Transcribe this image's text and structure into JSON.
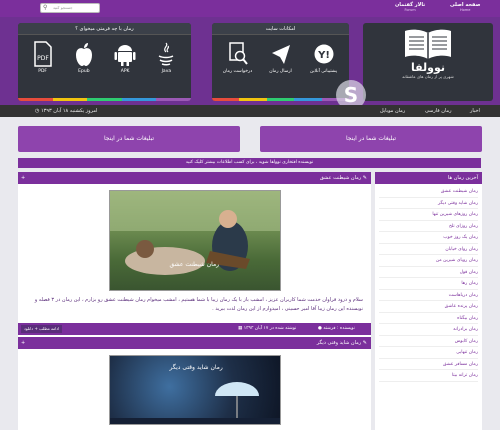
{
  "topbar": {
    "search_placeholder": "جستجو کنید",
    "nav": [
      {
        "label": "صفحه اصلی",
        "sub": "Home"
      },
      {
        "label": "تالار گفتمان",
        "sub": "Forum"
      }
    ]
  },
  "formats_panel": {
    "title": "رمان با چه فرمتی میخوای ؟",
    "items": [
      {
        "label": "PDF",
        "icon": "pdf-icon"
      },
      {
        "label": "Epub",
        "icon": "apple-icon"
      },
      {
        "label": "APK",
        "icon": "android-icon"
      },
      {
        "label": "Java",
        "icon": "java-icon"
      }
    ]
  },
  "site_panel": {
    "title": "امکانات سایت",
    "items": [
      {
        "label": "درخواست رمان",
        "icon": "request-icon"
      },
      {
        "label": "ارسال رمان",
        "icon": "send-icon"
      },
      {
        "label": "پشتیبانی آنلاین",
        "icon": "support-icon"
      }
    ]
  },
  "logo": {
    "name": "نوولفا",
    "slogan": "شهری پر از رمان های عاشقانه"
  },
  "navbar": {
    "date": "امروز یکشنبه ۱۸ آبان ۱۳۹۳",
    "items": [
      "اخبار",
      "رمان فارسی",
      "رمان موبایل"
    ]
  },
  "ads": {
    "left": "تبلیغات شما در اینجا",
    "right": "تبلیغات شما در اینجا"
  },
  "notice": "نویسنده افتخاری نوولفا شوید ، برای کسب اطلاعات بیشتر کلیک کنید",
  "posts": [
    {
      "title": "رمان شیطنت عشق",
      "image_caption": "رمان شیطنت عشق",
      "excerpt": "سلام و درود فراوان خدمت شما کاربران عزیز ، امشب باز با یک رمان زیبا با شما هستیم ، امشب میخوام رمان شیطنت عشق رو بزارم ، این رمان در ۳ فصله و نویسنده این رمان زیبا آقا امیر حسینی ، امیدوارم از این رمان لذت ببرید .",
      "author": "نویسنده : فرشته",
      "date": "نوشته شده در ۱۷ آبان ۱۳۹۳",
      "more": "ادامه مطلب + دانلود"
    },
    {
      "title": "رمان شاید وقتی دیگر",
      "image_caption": "رمان شاید وقتی دیگر"
    }
  ],
  "sidebar": {
    "title": "آخرین رمان ها",
    "items": [
      "رمان شیطنت عشق",
      "رمان شاید وقتی دیگر",
      "رمان روزهای شیرین تنها",
      "رمان روزای تلخ",
      "رمان یک روز خوب",
      "رمان روای خیابان",
      "رمان رویای شیرین من",
      "رمان قول",
      "رمان رها",
      "رمان دریاهاست",
      "رمان پرنده عاشق",
      "رمان بیگناه",
      "رمان برادرانه",
      "رمان کابوس",
      "رمان تنهایی",
      "رمان مسافر عشق",
      "رمان ترانه بیتا"
    ]
  },
  "colors": {
    "purple": "#7b2f9c",
    "panel": "#30343c",
    "stripe": [
      "#e74c3c",
      "#f1c40f",
      "#2ecc71",
      "#3498db",
      "#9b59b6"
    ]
  }
}
